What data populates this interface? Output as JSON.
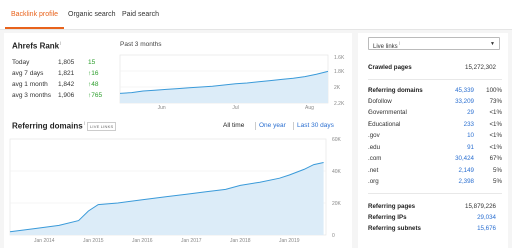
{
  "tabs": [
    {
      "label": "Backlink profile",
      "active": true
    },
    {
      "label": "Organic search",
      "active": false
    },
    {
      "label": "Paid search",
      "active": false
    }
  ],
  "ahrefs_rank": {
    "title": "Ahrefs Rank",
    "info": "i",
    "rows": [
      {
        "label": "Today",
        "value": "1,805",
        "change": "15"
      },
      {
        "label": "avg 7 days",
        "value": "1,821",
        "change": "↑16"
      },
      {
        "label": "avg 1 month",
        "value": "1,842",
        "change": "↑48"
      },
      {
        "label": "avg 3 months",
        "value": "1,906",
        "change": "↑765"
      }
    ],
    "period_label": "Past 3 months"
  },
  "referring_domains_section": {
    "title": "Referring domains",
    "info": "i",
    "badge": "LIVE LINKS",
    "ranges": [
      "All time",
      "One year",
      "Last 30 days"
    ]
  },
  "right_panel": {
    "select_value": "Live links",
    "select_info": "i",
    "crawled_pages": {
      "label": "Crawled pages",
      "info": "i",
      "value": "15,272,302"
    },
    "referring_domains": {
      "label": "Referring domains",
      "info": "i",
      "value": "45,339",
      "pct": "100%"
    },
    "breakdown": [
      {
        "label": "Dofollow",
        "info": "i",
        "value": "33,209",
        "pct": "73%"
      },
      {
        "label": "Governmental",
        "info": "i",
        "value": "29",
        "pct": "<1%"
      },
      {
        "label": "Educational",
        "info": "i",
        "value": "233",
        "pct": "<1%"
      },
      {
        "label": ".gov",
        "info": "",
        "value": "10",
        "pct": "<1%"
      },
      {
        "label": ".edu",
        "info": "",
        "value": "91",
        "pct": "<1%"
      },
      {
        "label": ".com",
        "info": "",
        "value": "30,424",
        "pct": "67%"
      },
      {
        "label": ".net",
        "info": "",
        "value": "2,149",
        "pct": "5%"
      },
      {
        "label": ".org",
        "info": "",
        "value": "2,398",
        "pct": "5%"
      }
    ],
    "referring_pages": {
      "label": "Referring pages",
      "value": "15,879,226"
    },
    "referring_ips": {
      "label": "Referring IPs",
      "value": "29,034"
    },
    "referring_subnets": {
      "label": "Referring subnets",
      "value": "15,676"
    }
  },
  "colors": {
    "accent": "#e8631c",
    "link": "#2a6fd1",
    "positive": "#2a9d2a",
    "chart_line": "#3a9ad9",
    "chart_fill": "#dcecf8"
  },
  "chart_data": [
    {
      "type": "area",
      "title": "Past 3 months",
      "x_ticks": [
        "Jun",
        "Jul",
        "Aug"
      ],
      "y_ticks": [
        "1.8K",
        "2K",
        "2.2K"
      ],
      "y_ticks_top": "1.6K",
      "ylim": [
        1600,
        2200
      ],
      "y_inverted": true,
      "x": [
        0,
        5,
        10,
        15,
        20,
        25,
        30,
        35,
        40,
        45,
        50,
        55,
        60,
        65,
        70,
        75,
        80,
        85,
        90
      ],
      "values": [
        2080,
        2070,
        2050,
        2040,
        2030,
        2020,
        2010,
        2000,
        1990,
        1975,
        1960,
        1950,
        1935,
        1920,
        1905,
        1890,
        1870,
        1840,
        1805
      ]
    },
    {
      "type": "area",
      "title": "Referring domains",
      "x_ticks": [
        "Jan 2014",
        "Jan 2015",
        "Jan 2016",
        "Jan 2017",
        "Jan 2018",
        "Jan 2019"
      ],
      "y_ticks": [
        "60K",
        "40K",
        "20K",
        "0"
      ],
      "ylim": [
        0,
        60000
      ],
      "x": [
        2013.3,
        2013.8,
        2014.3,
        2014.7,
        2014.9,
        2015.1,
        2015.5,
        2016.0,
        2016.5,
        2016.9,
        2017.3,
        2017.7,
        2018.0,
        2018.4,
        2018.8,
        2019.0,
        2019.3,
        2019.5,
        2019.7
      ],
      "values": [
        2000,
        4000,
        6000,
        9000,
        15000,
        19000,
        20000,
        22000,
        24000,
        25500,
        27000,
        28500,
        31000,
        33000,
        35500,
        37500,
        41000,
        44000,
        45300
      ]
    }
  ]
}
